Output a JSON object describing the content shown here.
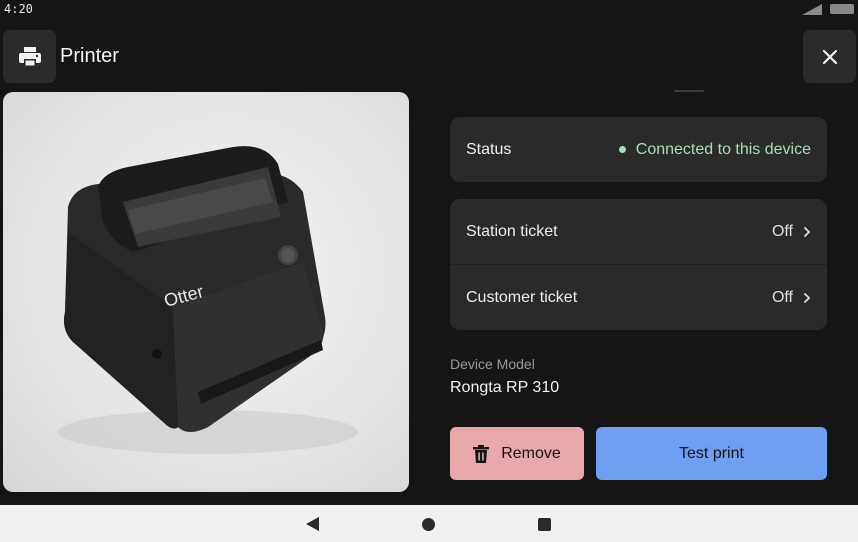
{
  "status_bar": {
    "time": "4:20",
    "icons": [
      "signal-icon",
      "battery-icon"
    ]
  },
  "header": {
    "icon": "printer-icon",
    "title": "Printer",
    "close_icon": "close-icon"
  },
  "device_image": {
    "brand_text": "Otter"
  },
  "status_card": {
    "label": "Status",
    "value": "Connected to this device",
    "value_color": "#a6dfb3"
  },
  "settings_card": {
    "items": [
      {
        "label": "Station ticket",
        "value": "Off",
        "icon": "chevron-right-icon"
      },
      {
        "label": "Customer ticket",
        "value": "Off",
        "icon": "chevron-right-icon"
      }
    ]
  },
  "device_model": {
    "label": "Device Model",
    "value": "Rongta RP 310"
  },
  "actions": {
    "remove_label": "Remove",
    "remove_icon": "trash-icon",
    "remove_color": "#e8a7ab",
    "test_print_label": "Test print",
    "test_print_color": "#6f9ff0"
  },
  "nav_bar": {
    "icons": [
      "back-icon",
      "home-icon",
      "recents-icon"
    ]
  }
}
